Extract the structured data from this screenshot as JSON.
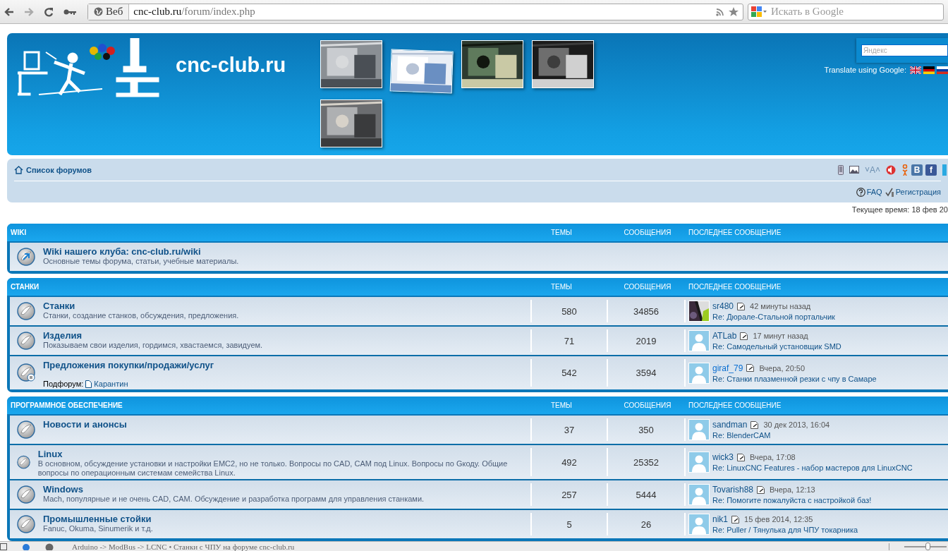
{
  "browser": {
    "address": {
      "badge": "Веб",
      "domain": "cnc-club.ru",
      "path": "/forum/index.php"
    },
    "search": {
      "placeholder": "Искать в Google"
    }
  },
  "header": {
    "site_title": "cnc-club.ru",
    "search": {
      "placeholder": "Яндекс"
    },
    "translate_label": "Translate using Google:"
  },
  "navbar": {
    "breadcrumb": "Список форумов",
    "font_size_control": "˅A˄",
    "share_buttons": [
      {
        "label": "В",
        "color": "#4a76a8"
      },
      {
        "label": "f",
        "color": "#3b5998"
      }
    ],
    "links": [
      "FAQ",
      "Регистрация"
    ]
  },
  "current_time": "Текущее время: 18 фев 20",
  "sections": [
    {
      "title": "WIKI",
      "columns": [
        "ТЕМЫ",
        "СООБЩЕНИЯ",
        "ПОСЛЕДНЕЕ СООБЩЕНИЕ"
      ],
      "forums": [
        {
          "kind": "link",
          "title": "Wiki нашего клуба: cnc-club.ru/wiki",
          "description": "Основные темы форума, статьи, учебные материалы."
        }
      ]
    },
    {
      "title": "СТАНКИ",
      "columns": [
        "ТЕМЫ",
        "СООБЩЕНИЯ",
        "ПОСЛЕДНЕЕ СООБЩЕНИЕ"
      ],
      "forums": [
        {
          "kind": "forum",
          "title": "Станки",
          "description": "Станки, создание станков, обсуждения, предложения.",
          "topics": "580",
          "posts": "34856",
          "last_post": {
            "author": "sr480",
            "color": "#105289",
            "time": "42 минуты назад",
            "subject": "Re: Дюрале-Стальной портальчик"
          }
        },
        {
          "kind": "forum",
          "title": "Изделия",
          "description": "Показываем свои изделия, гордимся, хвастаемся, завидуем.",
          "topics": "71",
          "posts": "2019",
          "last_post": {
            "avatar": {
              "kind": "silhouette"
            },
            "author": "ATLab",
            "color": "#105289",
            "time": "17 минут назад",
            "subject": "Re: Самодельный установщик SMD"
          }
        },
        {
          "kind": "forum",
          "title": "Предложения покупки/продажи/услуг",
          "subforum_label": "Подфорум:",
          "subforum": "Карантин",
          "topics": "542",
          "posts": "3594",
          "last_post": {
            "avatar": {
              "kind": "silhouette"
            },
            "author": "giraf_79",
            "color": "#0a6ed1",
            "time": "Вчера, 20:50",
            "subject": "Re: Станки плазменной резки с чпу в Самаре"
          }
        }
      ]
    },
    {
      "title": "ПРОГРАММНОЕ ОБЕСПЕЧЕНИЕ",
      "columns": [
        "ТЕМЫ",
        "СООБЩЕНИЯ",
        "ПОСЛЕДНЕЕ СООБЩЕНИЕ"
      ],
      "forums": [
        {
          "kind": "forum",
          "title": "Новости и анонсы",
          "topics": "37",
          "posts": "350",
          "last_post": {
            "avatar": {
              "kind": "silhouette"
            },
            "author": "sandman",
            "color": "#105289",
            "time": "30 дек 2013, 16:04",
            "subject": "Re: BlenderCAM"
          }
        },
        {
          "kind": "forum",
          "title": "Linux",
          "description": "В основном, обсуждение установки и настройки EMC2, но не только. Вопросы по CAD, CAM под Linux. Вопросы по Gкоду. Общие вопросы по операционным системам семейства Linux.",
          "topics": "492",
          "posts": "25352",
          "last_post": {
            "avatar": {
              "kind": "silhouette"
            },
            "author": "wick3",
            "color": "#105289",
            "time": "Вчера, 17:08",
            "subject": "Re: LinuxCNC Features - набор мастеров для LinuxCNC"
          }
        },
        {
          "kind": "forum",
          "title": "Windows",
          "description": "Mach, популярные и не очень CAD, CAM. Обсуждение и разработка программ для управления станками.",
          "topics": "257",
          "posts": "5444",
          "last_post": {
            "avatar": {
              "kind": "silhouette"
            },
            "author": "Tovarish88",
            "color": "#105289",
            "time": "Вчера, 12:13",
            "subject": "Re: Помогите пожалуйста с настройкой баз!"
          }
        },
        {
          "kind": "forum",
          "title": "Промышленные стойки",
          "description": "Fanuc, Okuma, Sinumerik и т.д.",
          "topics": "5",
          "posts": "26",
          "last_post": {
            "avatar": {
              "kind": "silhouette"
            },
            "author": "nik1",
            "color": "#105289",
            "time": "15 фев 2014, 12:35",
            "subject": "Re: Puller / Тянулька для ЧПУ токарника"
          }
        }
      ]
    }
  ],
  "status_bar": {
    "page_title": "Arduino -> ModBus -> LCNC • Станки с ЧПУ на форуме cnc-club.ru",
    "zoom_slider": {
      "level": 0.55
    }
  }
}
